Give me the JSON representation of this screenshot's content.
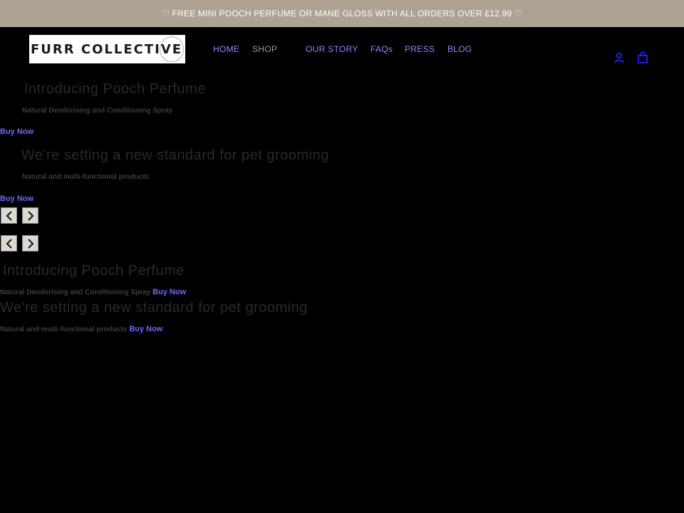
{
  "announcement": "♡ FREE MINI POOCH PERFUME OR MANE GLOSS WITH ALL ORDERS OVER £12.99 ♡",
  "logo": {
    "text_a": "FURR",
    "text_b": " COLLECTIVE"
  },
  "nav": {
    "home": "HOME",
    "shop": "SHOP",
    "our_story": "OUR STORY",
    "faqs": "FAQs",
    "press": "PRESS",
    "blog": "BLOG"
  },
  "icons": {
    "account": "account-icon",
    "cart": "cart-icon",
    "prev": "chevron-left-icon",
    "next": "chevron-right-icon"
  },
  "slides": [
    {
      "title": "Introducing Pooch Perfume",
      "subtitle": "Natural Deodorising and Conditioning Spray",
      "cta": "Buy Now"
    },
    {
      "title": "We're setting a new standard for pet grooming",
      "subtitle": "Natural and multi-functional products",
      "cta": "Buy Now"
    }
  ],
  "mobile_slides": [
    {
      "title": "Introducing Pooch Perfume",
      "subtitle": "Natural Deodorising and Conditioning Spray",
      "cta": "Buy Now"
    },
    {
      "title": "We're setting a new standard for pet grooming",
      "subtitle": "Natural and multi-functional products",
      "cta": "Buy Now"
    }
  ],
  "colors": {
    "announcement_bg": "#aca393",
    "link": "#8a8aff",
    "background": "#000000"
  }
}
